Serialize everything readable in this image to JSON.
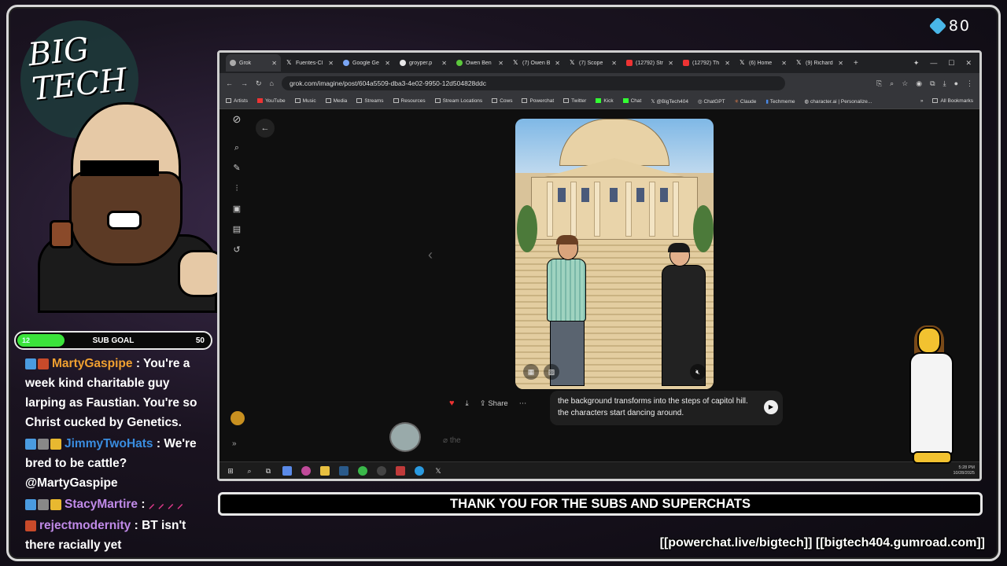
{
  "overlay": {
    "gem_count": "80",
    "logo_text": "BIG TECH",
    "sub_goal": {
      "label": "SUB GOAL",
      "current": "12",
      "target": "50",
      "progress_fraction": 0.24
    },
    "banner": "THANK YOU FOR THE SUBS AND SUPERCHATS",
    "footer_links": "[[powerchat.live/bigtech]] [[bigtech404.gumroad.com]]"
  },
  "chat": [
    {
      "name": "MartyGaspipe",
      "text": ": You're a week kind charitable guy larping as Faustian. You're so Christ cucked by Genetics."
    },
    {
      "name": "JimmyTwoHats",
      "text": ": We're bred to be cattle? @MartyGaspipe"
    },
    {
      "name": "StacyMartire",
      "text": ":"
    },
    {
      "name": "rejectmodernity",
      "text": ": BT isn't there racially yet"
    }
  ],
  "browser": {
    "tabs": [
      {
        "label": "Grok",
        "active": true,
        "icon": "grok-icon"
      },
      {
        "label": "Fuentes-Cl",
        "icon": "x-icon"
      },
      {
        "label": "Google Ge",
        "icon": "gemini-icon"
      },
      {
        "label": "groyper.p",
        "icon": "google-icon"
      },
      {
        "label": "Owen Ben",
        "icon": "rumble-icon"
      },
      {
        "label": "(7) Owen B",
        "icon": "x-icon"
      },
      {
        "label": "(7) Scope",
        "icon": "x-icon"
      },
      {
        "label": "(12792) Str",
        "icon": "youtube-icon"
      },
      {
        "label": "(12792) Th",
        "icon": "youtube-icon"
      },
      {
        "label": "(6) Home",
        "icon": "x-icon"
      },
      {
        "label": "(9) Richard",
        "icon": "x-icon"
      }
    ],
    "url": "grok.com/imagine/post/604a5509-dba3-4e02-9950-12d504828ddc",
    "bookmarks": [
      "Artists",
      "YouTube",
      "Music",
      "Media",
      "Streams",
      "Resources",
      "Stream Locations",
      "Cows",
      "Powerchat",
      "Twitter",
      "Kick",
      "Chat",
      "@BigTech404",
      "ChatGPT",
      "Claude",
      "Techmeme",
      "character.ai | Personalize..."
    ],
    "all_bookmarks": "All Bookmarks",
    "share_label": "Share",
    "prompt_text": "the background transforms into the steps of capitol hill. the characters start dancing around.",
    "compose_text": "the",
    "taskbar_time": "5:28 PM",
    "taskbar_date": "10/28/2025"
  }
}
